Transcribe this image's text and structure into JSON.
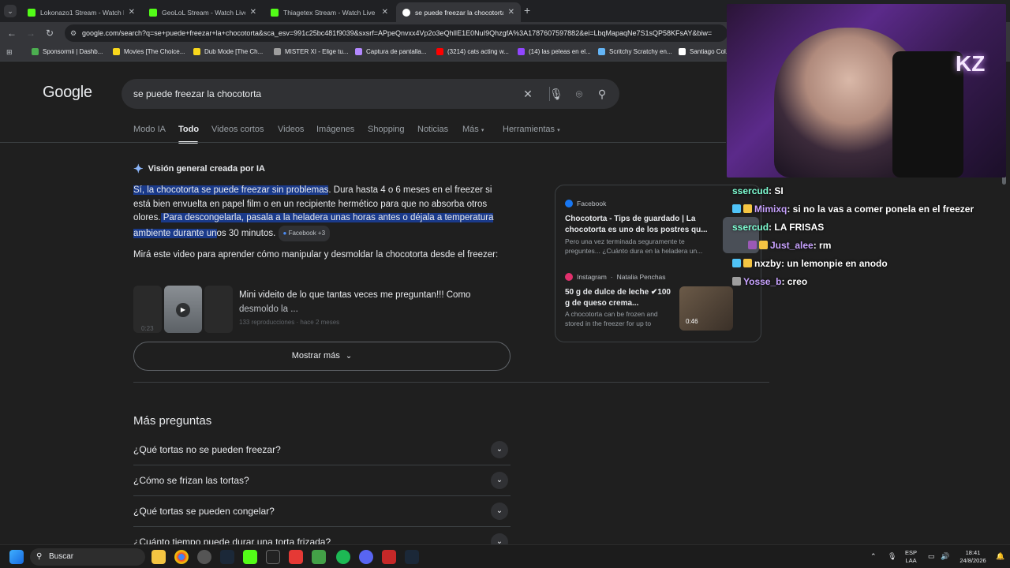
{
  "browser": {
    "tabs": [
      {
        "title": "Lokonazo1 Stream - Watch Live",
        "favicon_color": "#53fc18",
        "active": false
      },
      {
        "title": "GeoLoL Stream - Watch Live",
        "favicon_color": "#53fc18",
        "active": false
      },
      {
        "title": "Thiagetex Stream - Watch Live",
        "favicon_color": "#53fc18",
        "active": false
      },
      {
        "title": "se puede freezar la chocotorta",
        "favicon_color": "#ffffff",
        "active": true
      }
    ],
    "new_tab_label": "+",
    "url": "google.com/search?q=se+puede+freezar+la+chocotorta&sca_esv=991c25bc481f9039&sxsrf=APpeQnvxx4Vp2o3eQhlIE1E0NuI9QhzgfA%3A1787607597882&ei=LbqMapaqNe7S1sQP58KFsAY&biw=",
    "bookmarks": [
      {
        "label": "Sponsormii | Dashb...",
        "color": "#4caf50"
      },
      {
        "label": "Movies [The Choice...",
        "color": "#f9d71c"
      },
      {
        "label": "Dub Mode [The Ch...",
        "color": "#f9d71c"
      },
      {
        "label": "MISTER XI - Elige tu...",
        "color": "#9e9e9e"
      },
      {
        "label": "Captura de pantalla...",
        "color": "#b388ff"
      },
      {
        "label": "(3214) cats acting w...",
        "color": "#ff0000"
      },
      {
        "label": "(14) las peleas en el...",
        "color": "#9146ff"
      },
      {
        "label": "Scritchy Scratchy en...",
        "color": "#64b5f6"
      },
      {
        "label": "Santiago Col...",
        "color": "#ffffff"
      }
    ]
  },
  "google": {
    "logo": "Google",
    "query": "se puede freezar la chocotorta",
    "tabs": [
      "Modo IA",
      "Todo",
      "Videos cortos",
      "Videos",
      "Imágenes",
      "Shopping",
      "Noticias",
      "Más",
      "Herramientas"
    ],
    "ai_overview": {
      "heading": "Visión general creada por IA",
      "p1_hl": "Sí, la chocotorta se puede freezar sin problemas",
      "p1_rest": ". Dura hasta 4 o 6 meses en el freezer si está bien envuelta en papel film o en un recipiente hermético para que no absorba otros olores.",
      "p1_hl2": " Para descongelarla, pasala a la heladera unas horas antes o déjala a temperatura ambiente durante un",
      "p1_end": "os 30 minutos.",
      "source_pill": "Facebook +3",
      "p2": "Mirá este video para aprender cómo manipular y desmoldar la chocotorta desde el freezer:",
      "video_title": "Mini videito de lo que tantas veces me preguntan!!! Como",
      "video_title2": "desmoldo la ...",
      "video_meta": "133 reproducciones · hace 2 meses",
      "video_duration": "0:23",
      "show_more": "Mostrar más"
    },
    "cards": [
      {
        "source": "Facebook",
        "title": "Chocotorta - Tips de guardado | La chocotorta es uno de los postres qu...",
        "snippet": "Pero una vez terminada seguramente te preguntes... ¿Cuánto dura en la heladera un..."
      },
      {
        "source": "Instagram",
        "author": "Natalia Penchas",
        "title": "50 g de dulce de leche ✔100 g de queso crema...",
        "snippet": "A chocotorta can be frozen and stored in the freezer for up to",
        "duration": "0:46"
      }
    ],
    "more_questions": {
      "heading": "Más preguntas",
      "items": [
        "¿Qué tortas no se pueden freezar?",
        "¿Cómo se frizan las tortas?",
        "¿Qué tortas se pueden congelar?",
        "¿Cuánto tiempo puede durar una torta frizada?"
      ]
    }
  },
  "chat": [
    {
      "user": "ssercud",
      "text": ": SI"
    },
    {
      "user": "Mimixq",
      "text": ": si no la vas a comer ponela en el freezer"
    },
    {
      "user": "ssercud",
      "text": ": LA FRISAS"
    },
    {
      "user": "Just_alee",
      "text": ": rm"
    },
    {
      "user": "nxzby",
      "text": ": un lemonpie en anodo"
    },
    {
      "user": "Yosse_b",
      "text": ": creo"
    }
  ],
  "taskbar": {
    "search": "Buscar",
    "lang1": "ESP",
    "lang2": "LAA",
    "time": "18:41",
    "date": "24/8/2026"
  },
  "colors": {
    "accent": "#8ab4f8",
    "highlight": "#1a3a8a",
    "kick": "#53fc18"
  }
}
